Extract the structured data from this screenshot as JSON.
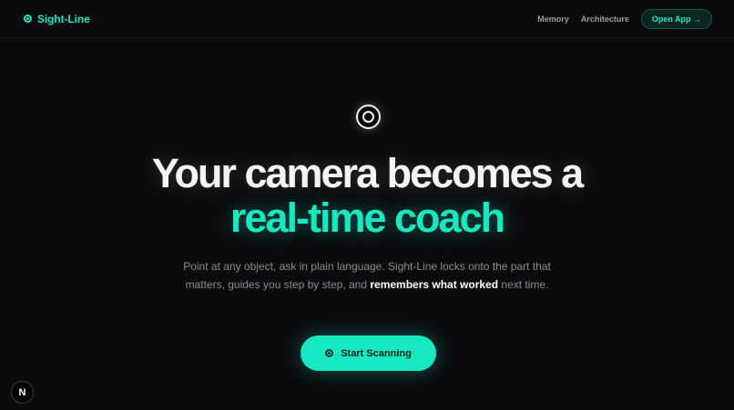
{
  "header": {
    "brand_name": "Sight-Line",
    "brand_icon": "target-icon",
    "nav": [
      {
        "label": "Memory"
      },
      {
        "label": "Architecture"
      }
    ],
    "open_app_label": "Open App →"
  },
  "hero": {
    "icon": "target-icon",
    "headline_line1": "Your camera becomes a",
    "headline_line2": "real-time coach",
    "subtitle_part1": "Point at any object, ask in plain language. Sight-Line locks onto the part that matters, guides you step by step, and ",
    "subtitle_bold": "remembers what worked",
    "subtitle_part2": " next time.",
    "cta_label": "Start Scanning",
    "cta_icon": "target-icon"
  },
  "badge": {
    "label": "N"
  },
  "colors": {
    "background": "#0b0b0e",
    "accent": "#17e8c2",
    "text": "#f4f4f4",
    "muted": "#8a8a96"
  }
}
